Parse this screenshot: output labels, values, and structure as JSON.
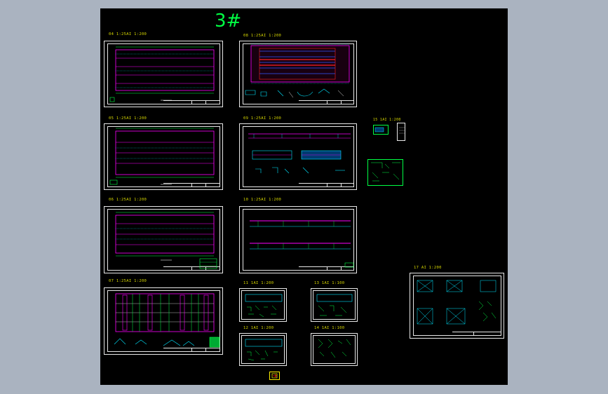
{
  "drawing": {
    "title": "3#",
    "labels": {
      "s04": "04  1:25AI  1:200",
      "s05": "05  1:25AI  1:200",
      "s06": "06  1:25AI  1:200",
      "s07": "07  1:25AI  1:200",
      "s08": "08  1:25AI  1:200",
      "s09": "09  1:25AI  1:200",
      "s10": "10  1:25AI  1:200",
      "s11": "11  1AI  1:200",
      "s12": "12  1AI  1:200",
      "s13": "13  1AI  1:100",
      "s14": "14  1AI  1:100",
      "s15": "15 1AI 1:200",
      "s17": "17  AI  1:200"
    }
  },
  "colors": {
    "background": "#000000",
    "frame": "#e8e8e8",
    "label": "#d8d800",
    "title": "#00ff44",
    "magenta": "#ff00ff",
    "cyan": "#00e5ff",
    "red": "#ff2020",
    "green": "#00ff44",
    "yellow": "#ffee00",
    "blue": "#3355ff"
  },
  "icons": {
    "nav": "arrow-right-icon"
  }
}
